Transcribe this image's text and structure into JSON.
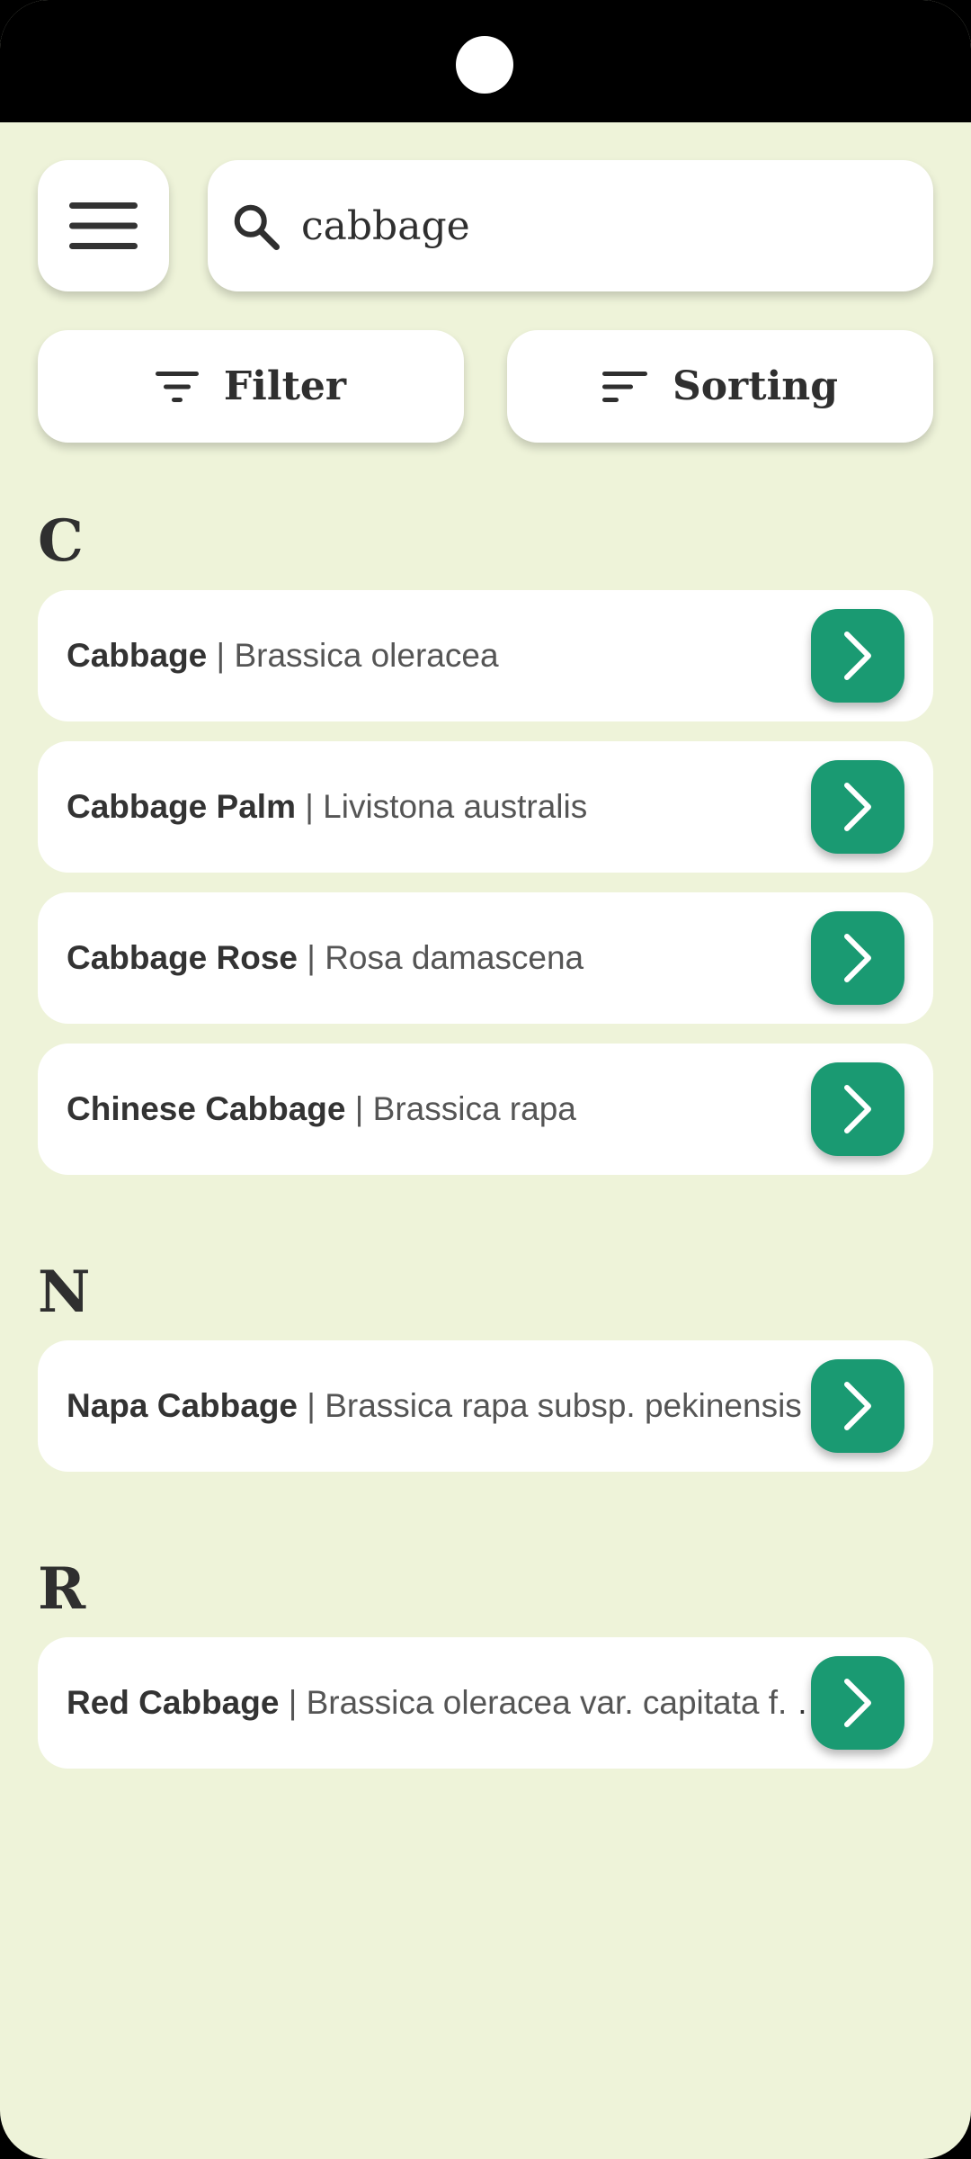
{
  "search": {
    "value": "cabbage"
  },
  "buttons": {
    "filter_label": "Filter",
    "sorting_label": "Sorting"
  },
  "icons": {
    "menu": "menu-icon",
    "search": "search-icon",
    "filter": "filter-icon",
    "sort": "sort-icon",
    "row_arrow": "chevron-right-icon"
  },
  "colors": {
    "background": "#eef3d9",
    "accent": "#1a9a72",
    "card": "#ffffff"
  },
  "sections": [
    {
      "letter": "C",
      "items": [
        {
          "name": "Cabbage",
          "separator": " | ",
          "scientific": "Brassica oleracea"
        },
        {
          "name": "Cabbage Palm",
          "separator": " | ",
          "scientific": "Livistona australis"
        },
        {
          "name": "Cabbage Rose",
          "separator": " | ",
          "scientific": "Rosa damascena"
        },
        {
          "name": "Chinese Cabbage",
          "separator": " | ",
          "scientific": "Brassica rapa"
        }
      ]
    },
    {
      "letter": "N",
      "items": [
        {
          "name": "Napa Cabbage",
          "separator": " | ",
          "scientific": "Brassica rapa subsp. pekinensis"
        }
      ]
    },
    {
      "letter": "R",
      "items": [
        {
          "name": "Red Cabbage",
          "separator": " | ",
          "scientific": "Brassica oleracea var. capitata f. rubra"
        }
      ]
    }
  ]
}
